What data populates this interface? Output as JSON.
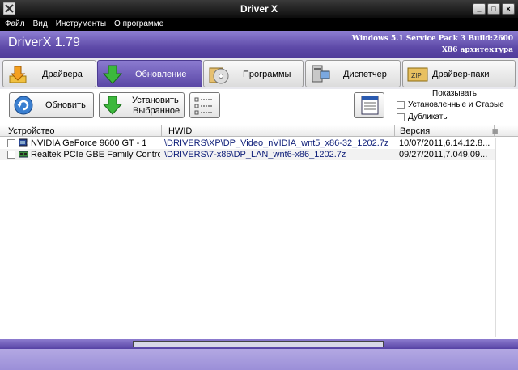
{
  "window": {
    "title": "Driver X"
  },
  "menu": [
    "Файл",
    "Вид",
    "Инструменты",
    "О программе"
  ],
  "banner": {
    "brand": "DriverX 1.79",
    "system_line1": "Windows 5.1 Service Pack 3 Build:2600",
    "system_line2": "X86 архитектура"
  },
  "tabs": [
    {
      "label": "Драйвера",
      "icon": "download-arrow-icon",
      "active": false
    },
    {
      "label": "Обновление",
      "icon": "green-arrow-down-icon",
      "active": true
    },
    {
      "label": "Программы",
      "icon": "disc-icon",
      "active": false
    },
    {
      "label": "Диспетчер",
      "icon": "computer-icon",
      "active": false
    },
    {
      "label": "Драйвер-паки",
      "icon": "zip-archive-icon",
      "active": false
    }
  ],
  "toolbar": {
    "refresh_label": "Обновить",
    "install_label_line1": "Установить",
    "install_label_line2": "Выбранное",
    "show_label": "Показывать",
    "filter_installed_old": "Установленные и Старые",
    "filter_duplicates": "Дубликаты"
  },
  "table": {
    "columns": [
      "Устройство",
      "HWID",
      "Версия"
    ],
    "rows": [
      {
        "device": "NVIDIA GeForce 9600 GT - 1",
        "hwid": "\\DRIVERS\\XP\\DP_Video_nVIDIA_wnt5_x86-32_1202.7z",
        "version": "10/07/2011,6.14.12.8..."
      },
      {
        "device": "Realtek PCIe GBE Family Controlle...",
        "hwid": "\\DRIVERS\\7-x86\\DP_LAN_wnt6-x86_1202.7z",
        "version": "09/27/2011,7.049.09..."
      }
    ]
  },
  "colors": {
    "accent_purple": "#5e4aa8",
    "hwid_text": "#10207a"
  }
}
